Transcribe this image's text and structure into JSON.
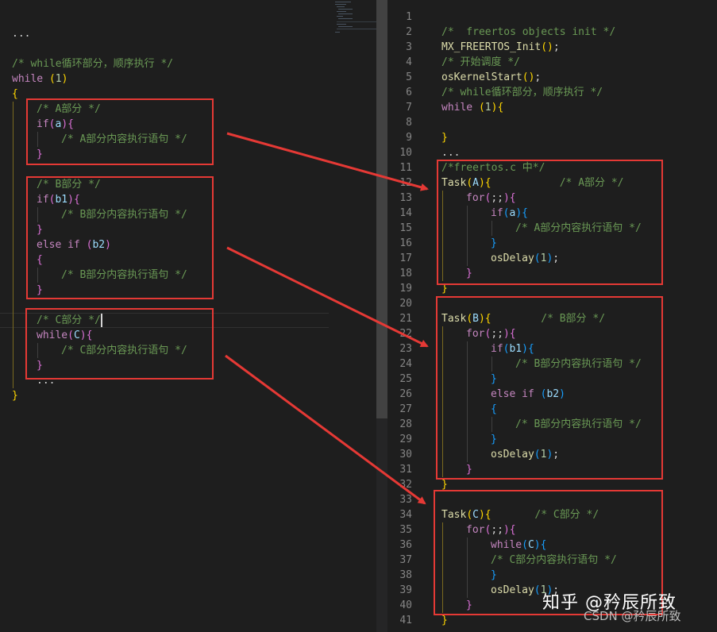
{
  "left_editor": {
    "lines": [
      {
        "t": 0,
        "indent": 0,
        "spans": [
          [
            "plain",
            "..."
          ]
        ]
      },
      {
        "t": 2,
        "indent": 0,
        "spans": [
          [
            "cmt",
            "/* while循环部分，顺序执行 */"
          ]
        ]
      },
      {
        "t": 3,
        "indent": 0,
        "spans": [
          [
            "kw",
            "while"
          ],
          [
            "plain",
            " "
          ],
          [
            "p1",
            "("
          ],
          [
            "num",
            "1"
          ],
          [
            "p1",
            ")"
          ]
        ]
      },
      {
        "t": 4,
        "indent": 0,
        "spans": [
          [
            "p1",
            "{"
          ]
        ]
      },
      {
        "t": 5,
        "indent": 1,
        "spans": [
          [
            "cmt",
            "/* A部分 */"
          ]
        ]
      },
      {
        "t": 6,
        "indent": 1,
        "spans": [
          [
            "kw",
            "if"
          ],
          [
            "p2",
            "("
          ],
          [
            "var",
            "a"
          ],
          [
            "p2",
            ")"
          ],
          [
            "p2",
            "{"
          ]
        ]
      },
      {
        "t": 7,
        "indent": 2,
        "spans": [
          [
            "cmt",
            "/* A部分内容执行语句 */"
          ]
        ]
      },
      {
        "t": 8,
        "indent": 1,
        "spans": [
          [
            "p2",
            "}"
          ]
        ]
      },
      {
        "t": 10,
        "indent": 1,
        "spans": [
          [
            "cmt",
            "/* B部分 */"
          ]
        ]
      },
      {
        "t": 11,
        "indent": 1,
        "spans": [
          [
            "kw",
            "if"
          ],
          [
            "p2",
            "("
          ],
          [
            "var",
            "b1"
          ],
          [
            "p2",
            ")"
          ],
          [
            "p2",
            "{"
          ]
        ]
      },
      {
        "t": 12,
        "indent": 2,
        "spans": [
          [
            "cmt",
            "/* B部分内容执行语句 */"
          ]
        ]
      },
      {
        "t": 13,
        "indent": 1,
        "spans": [
          [
            "p2",
            "}"
          ]
        ]
      },
      {
        "t": 14,
        "indent": 1,
        "spans": [
          [
            "kw",
            "else if"
          ],
          [
            "plain",
            " "
          ],
          [
            "p2",
            "("
          ],
          [
            "var",
            "b2"
          ],
          [
            "p2",
            ")"
          ]
        ]
      },
      {
        "t": 15,
        "indent": 1,
        "spans": [
          [
            "p2",
            "{"
          ]
        ]
      },
      {
        "t": 16,
        "indent": 2,
        "spans": [
          [
            "cmt",
            "/* B部分内容执行语句 */"
          ]
        ]
      },
      {
        "t": 17,
        "indent": 1,
        "spans": [
          [
            "p2",
            "}"
          ]
        ]
      },
      {
        "t": 19,
        "indent": 1,
        "spans": [
          [
            "cmt",
            "/* C部分 */"
          ]
        ]
      },
      {
        "t": 20,
        "indent": 1,
        "spans": [
          [
            "kw",
            "while"
          ],
          [
            "p2",
            "("
          ],
          [
            "var",
            "C"
          ],
          [
            "p2",
            ")"
          ],
          [
            "p2",
            "{"
          ]
        ]
      },
      {
        "t": 21,
        "indent": 2,
        "spans": [
          [
            "cmt",
            "/* C部分内容执行语句 */"
          ]
        ]
      },
      {
        "t": 22,
        "indent": 1,
        "spans": [
          [
            "p2",
            "}"
          ]
        ]
      },
      {
        "t": 23,
        "indent": 1,
        "spans": [
          [
            "plain",
            "..."
          ]
        ]
      },
      {
        "t": 24,
        "indent": 0,
        "spans": [
          [
            "p1",
            "}"
          ]
        ]
      }
    ]
  },
  "right_editor": {
    "line_numbers": [
      "1",
      "2",
      "3",
      "4",
      "5",
      "6",
      "7",
      "8",
      "9",
      "10",
      "11",
      "12",
      "13",
      "14",
      "15",
      "16",
      "17",
      "18",
      "19",
      "20",
      "21",
      "22",
      "23",
      "24",
      "25",
      "26",
      "27",
      "28",
      "29",
      "30",
      "31",
      "32",
      "33",
      "34",
      "35",
      "36",
      "37",
      "38",
      "39",
      "40",
      "41"
    ],
    "lines": [
      {
        "n": 2,
        "indent": 0,
        "spans": [
          [
            "cmt",
            "/*  freertos objects init */"
          ]
        ]
      },
      {
        "n": 3,
        "indent": 0,
        "spans": [
          [
            "fn",
            "MX_FREERTOS_Init"
          ],
          [
            "p1",
            "()"
          ],
          [
            "plain",
            ";"
          ]
        ]
      },
      {
        "n": 4,
        "indent": 0,
        "spans": [
          [
            "cmt",
            "/* 开始调度 */"
          ]
        ]
      },
      {
        "n": 5,
        "indent": 0,
        "spans": [
          [
            "fn",
            "osKernelStart"
          ],
          [
            "p1",
            "()"
          ],
          [
            "plain",
            ";"
          ]
        ]
      },
      {
        "n": 6,
        "indent": 0,
        "spans": [
          [
            "cmt",
            "/* while循环部分，顺序执行 */"
          ]
        ]
      },
      {
        "n": 7,
        "indent": 0,
        "spans": [
          [
            "kw",
            "while"
          ],
          [
            "plain",
            " "
          ],
          [
            "p1",
            "("
          ],
          [
            "num",
            "1"
          ],
          [
            "p1",
            ")"
          ],
          [
            "p1",
            "{"
          ]
        ]
      },
      {
        "n": 9,
        "indent": 0,
        "spans": [
          [
            "p1",
            "}"
          ]
        ]
      },
      {
        "n": 10,
        "indent": 0,
        "spans": [
          [
            "plain",
            "..."
          ]
        ]
      },
      {
        "n": 11,
        "indent": 0,
        "spans": [
          [
            "cmt",
            "/*freertos.c 中*/"
          ]
        ]
      },
      {
        "n": 12,
        "indent": 0,
        "spans": [
          [
            "fn",
            "Task"
          ],
          [
            "p1",
            "("
          ],
          [
            "var",
            "A"
          ],
          [
            "p1",
            ")"
          ],
          [
            "p1",
            "{"
          ],
          [
            "plain",
            "           "
          ],
          [
            "cmt",
            "/* A部分 */"
          ]
        ]
      },
      {
        "n": 13,
        "indent": 1,
        "spans": [
          [
            "kw",
            "for"
          ],
          [
            "p2",
            "("
          ],
          [
            "plain",
            ";;"
          ],
          [
            "p2",
            ")"
          ],
          [
            "p2",
            "{"
          ]
        ]
      },
      {
        "n": 14,
        "indent": 2,
        "spans": [
          [
            "kw",
            "if"
          ],
          [
            "p3",
            "("
          ],
          [
            "var",
            "a"
          ],
          [
            "p3",
            ")"
          ],
          [
            "p3",
            "{"
          ]
        ]
      },
      {
        "n": 15,
        "indent": 3,
        "spans": [
          [
            "cmt",
            "/* A部分内容执行语句 */"
          ]
        ]
      },
      {
        "n": 16,
        "indent": 2,
        "spans": [
          [
            "p3",
            "}"
          ]
        ]
      },
      {
        "n": 17,
        "indent": 2,
        "spans": [
          [
            "fn",
            "osDelay"
          ],
          [
            "p3",
            "("
          ],
          [
            "num",
            "1"
          ],
          [
            "p3",
            ")"
          ],
          [
            "plain",
            ";"
          ]
        ]
      },
      {
        "n": 18,
        "indent": 1,
        "spans": [
          [
            "p2",
            "}"
          ]
        ]
      },
      {
        "n": 19,
        "indent": 0,
        "spans": [
          [
            "p1",
            "}"
          ]
        ]
      },
      {
        "n": 21,
        "indent": 0,
        "spans": [
          [
            "fn",
            "Task"
          ],
          [
            "p1",
            "("
          ],
          [
            "var",
            "B"
          ],
          [
            "p1",
            ")"
          ],
          [
            "p1",
            "{"
          ],
          [
            "plain",
            "        "
          ],
          [
            "cmt",
            "/* B部分 */"
          ]
        ]
      },
      {
        "n": 22,
        "indent": 1,
        "spans": [
          [
            "kw",
            "for"
          ],
          [
            "p2",
            "("
          ],
          [
            "plain",
            ";;"
          ],
          [
            "p2",
            ")"
          ],
          [
            "p2",
            "{"
          ]
        ]
      },
      {
        "n": 23,
        "indent": 2,
        "spans": [
          [
            "kw",
            "if"
          ],
          [
            "p3",
            "("
          ],
          [
            "var",
            "b1"
          ],
          [
            "p3",
            ")"
          ],
          [
            "p3",
            "{"
          ]
        ]
      },
      {
        "n": 24,
        "indent": 3,
        "spans": [
          [
            "cmt",
            "/* B部分内容执行语句 */"
          ]
        ]
      },
      {
        "n": 25,
        "indent": 2,
        "spans": [
          [
            "p3",
            "}"
          ]
        ]
      },
      {
        "n": 26,
        "indent": 2,
        "spans": [
          [
            "kw",
            "else if"
          ],
          [
            "plain",
            " "
          ],
          [
            "p3",
            "("
          ],
          [
            "var",
            "b2"
          ],
          [
            "p3",
            ")"
          ]
        ]
      },
      {
        "n": 27,
        "indent": 2,
        "spans": [
          [
            "p3",
            "{"
          ]
        ]
      },
      {
        "n": 28,
        "indent": 3,
        "spans": [
          [
            "cmt",
            "/* B部分内容执行语句 */"
          ]
        ]
      },
      {
        "n": 29,
        "indent": 2,
        "spans": [
          [
            "p3",
            "}"
          ]
        ]
      },
      {
        "n": 30,
        "indent": 2,
        "spans": [
          [
            "fn",
            "osDelay"
          ],
          [
            "p3",
            "("
          ],
          [
            "num",
            "1"
          ],
          [
            "p3",
            ")"
          ],
          [
            "plain",
            ";"
          ]
        ]
      },
      {
        "n": 31,
        "indent": 1,
        "spans": [
          [
            "p2",
            "}"
          ]
        ]
      },
      {
        "n": 32,
        "indent": 0,
        "spans": [
          [
            "p1",
            "}"
          ]
        ]
      },
      {
        "n": 34,
        "indent": 0,
        "spans": [
          [
            "fn",
            "Task"
          ],
          [
            "p1",
            "("
          ],
          [
            "var",
            "C"
          ],
          [
            "p1",
            ")"
          ],
          [
            "p1",
            "{"
          ],
          [
            "plain",
            "       "
          ],
          [
            "cmt",
            "/* C部分 */"
          ]
        ]
      },
      {
        "n": 35,
        "indent": 1,
        "spans": [
          [
            "kw",
            "for"
          ],
          [
            "p2",
            "("
          ],
          [
            "plain",
            ";;"
          ],
          [
            "p2",
            ")"
          ],
          [
            "p2",
            "{"
          ]
        ]
      },
      {
        "n": 36,
        "indent": 2,
        "spans": [
          [
            "kw",
            "while"
          ],
          [
            "p3",
            "("
          ],
          [
            "var",
            "C"
          ],
          [
            "p3",
            ")"
          ],
          [
            "p3",
            "{"
          ]
        ]
      },
      {
        "n": 37,
        "indent": 2,
        "spans": [
          [
            "cmt",
            "/* C部分内容执行语句 */"
          ]
        ]
      },
      {
        "n": 38,
        "indent": 2,
        "spans": [
          [
            "p3",
            "}"
          ]
        ]
      },
      {
        "n": 39,
        "indent": 2,
        "spans": [
          [
            "fn",
            "osDelay"
          ],
          [
            "p3",
            "("
          ],
          [
            "num",
            "1"
          ],
          [
            "p3",
            ")"
          ],
          [
            "plain",
            ";"
          ]
        ]
      },
      {
        "n": 40,
        "indent": 1,
        "spans": [
          [
            "p2",
            "}"
          ]
        ]
      },
      {
        "n": 41,
        "indent": 0,
        "spans": [
          [
            "p1",
            "}"
          ]
        ]
      }
    ]
  },
  "annotations": {
    "box_color": "#e53935",
    "arrow_color": "#e53935"
  },
  "watermark": {
    "main": "知乎 @矜辰所致",
    "sub": "CSDN @矜辰所致"
  },
  "theme": {
    "background": "#1e1e1e",
    "comment": "#6a9955",
    "keyword": "#c586c0",
    "function": "#dcdcaa",
    "number": "#b5cea8"
  }
}
